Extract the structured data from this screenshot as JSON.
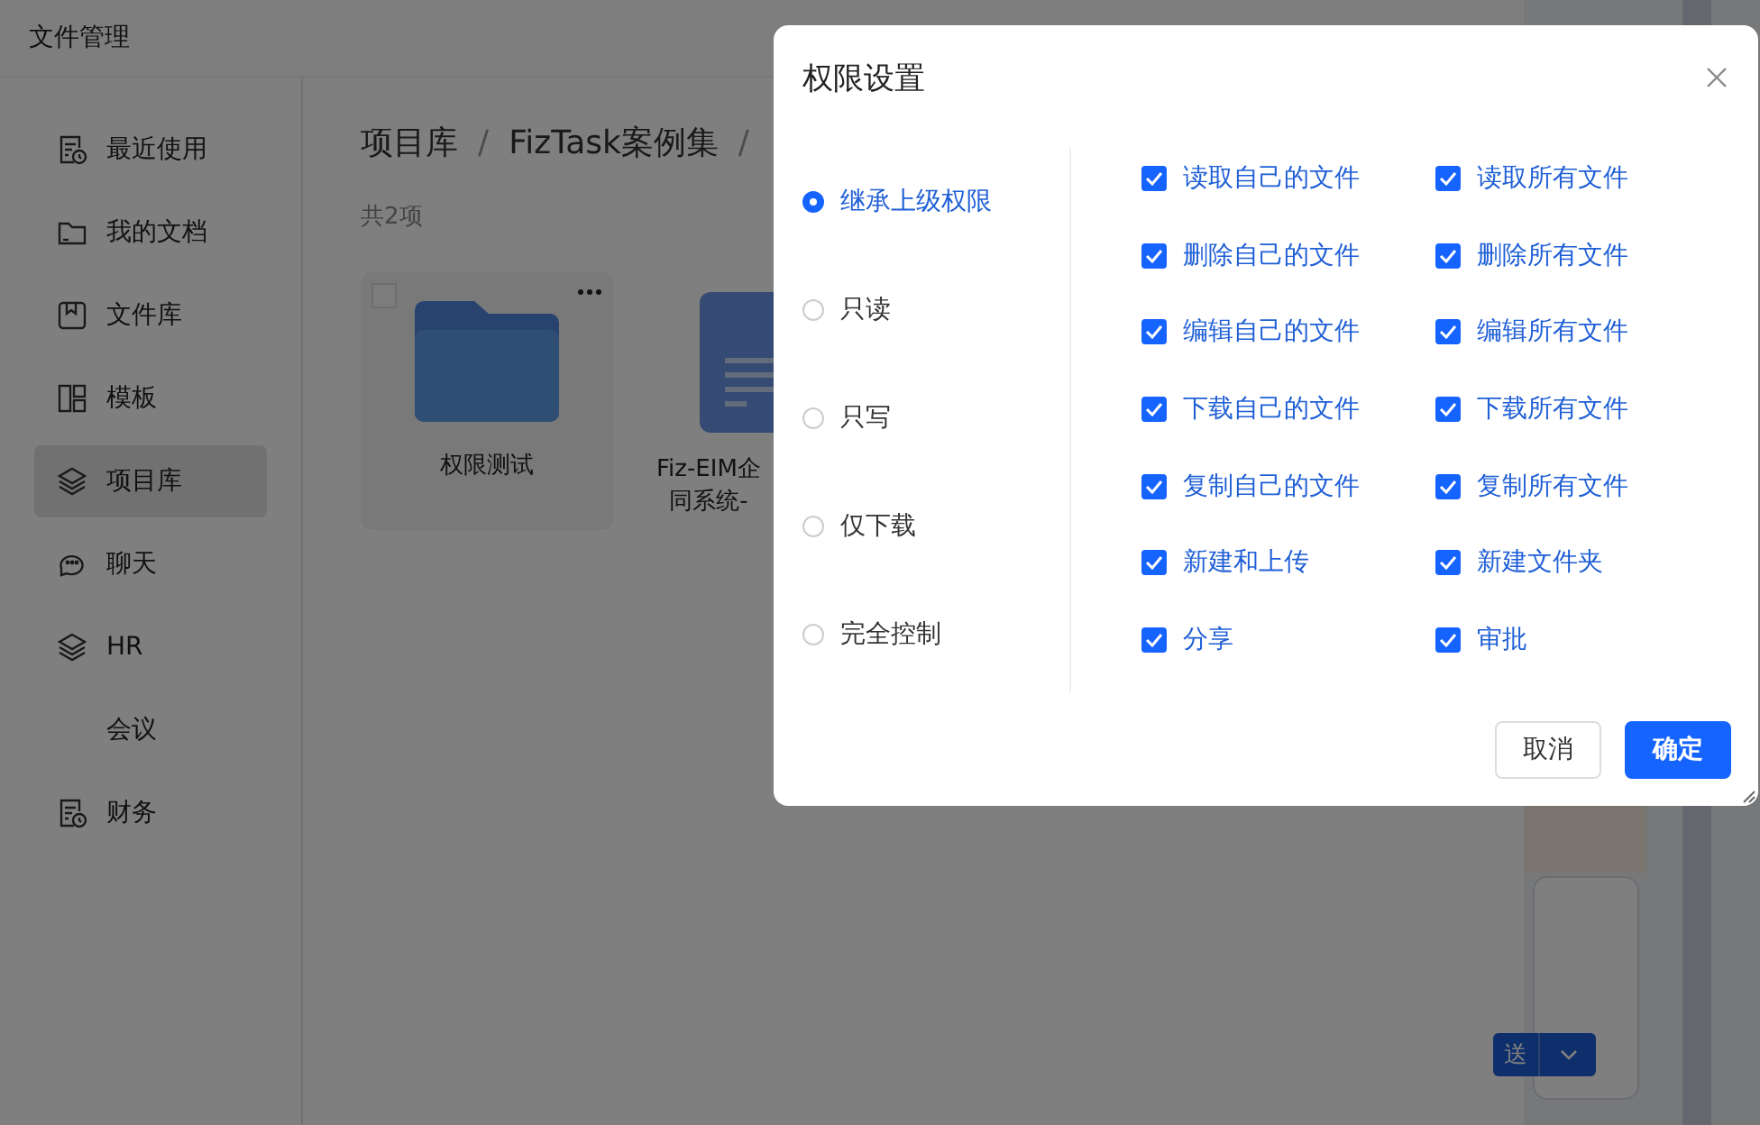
{
  "window": {
    "title": "文件管理"
  },
  "sidebar": {
    "items": [
      {
        "label": "最近使用",
        "kind": "recent",
        "selected": false
      },
      {
        "label": "我的文档",
        "kind": "folder",
        "selected": false
      },
      {
        "label": "文件库",
        "kind": "bookmark",
        "selected": false
      },
      {
        "label": "模板",
        "kind": "template",
        "selected": false
      },
      {
        "label": "项目库",
        "kind": "layers",
        "selected": true
      },
      {
        "label": "聊天",
        "kind": "chat",
        "selected": false
      },
      {
        "label": "HR",
        "kind": "layers",
        "selected": false
      },
      {
        "label": "会议",
        "kind": "plain",
        "selected": false
      },
      {
        "label": "财务",
        "kind": "recent",
        "selected": false
      }
    ]
  },
  "breadcrumb": [
    {
      "text": "项目库",
      "kind": "crumb"
    },
    {
      "text": "/",
      "kind": "separator"
    },
    {
      "text": "FizTask案例集",
      "kind": "crumb"
    },
    {
      "text": "/",
      "kind": "separator"
    }
  ],
  "count": "共2项",
  "files": [
    {
      "kind": "folder",
      "lines": [
        "权限测试"
      ],
      "checked": false
    },
    {
      "kind": "document",
      "lines": [
        "Fiz-EIM企",
        "同系统-"
      ]
    }
  ],
  "side_app": {
    "send_button": "送"
  },
  "dialog": {
    "title": "权限设置",
    "options": [
      {
        "label": "继承上级权限",
        "selected": true
      },
      {
        "label": "只读",
        "selected": false
      },
      {
        "label": "只写",
        "selected": false
      },
      {
        "label": "仅下载",
        "selected": false
      },
      {
        "label": "完全控制",
        "selected": false
      }
    ],
    "permissions": [
      {
        "label": "读取自己的文件",
        "checked": true
      },
      {
        "label": "读取所有文件",
        "checked": true
      },
      {
        "label": "删除自己的文件",
        "checked": true
      },
      {
        "label": "删除所有文件",
        "checked": true
      },
      {
        "label": "编辑自己的文件",
        "checked": true
      },
      {
        "label": "编辑所有文件",
        "checked": true
      },
      {
        "label": "下载自己的文件",
        "checked": true
      },
      {
        "label": "下载所有文件",
        "checked": true
      },
      {
        "label": "复制自己的文件",
        "checked": true
      },
      {
        "label": "复制所有文件",
        "checked": true
      },
      {
        "label": "新建和上传",
        "checked": true
      },
      {
        "label": "新建文件夹",
        "checked": true
      },
      {
        "label": "分享",
        "checked": true
      },
      {
        "label": "审批",
        "checked": true
      }
    ],
    "buttons": [
      {
        "label": "取消",
        "kind": "secondary"
      },
      {
        "label": "确定",
        "kind": "primary"
      }
    ]
  }
}
